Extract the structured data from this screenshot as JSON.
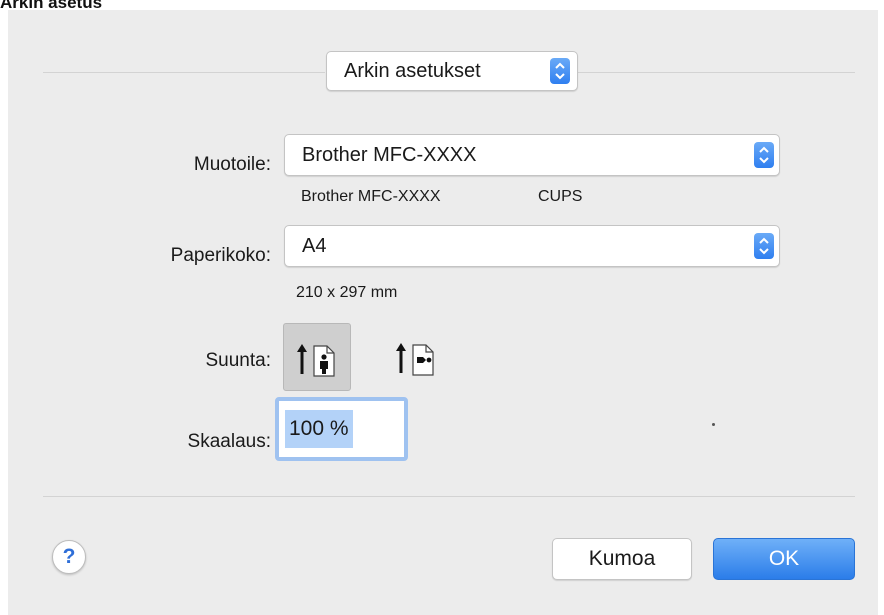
{
  "page": {
    "heading": "Arkin asetus"
  },
  "dialog": {
    "settings_popup": {
      "value": "Arkin asetukset"
    },
    "format_for": {
      "label": "Muotoile:",
      "value": "Brother MFC-XXXX",
      "details": {
        "model": "Brother MFC-XXXX",
        "driver": "CUPS"
      }
    },
    "paper_size": {
      "label": "Paperikoko:",
      "value": "A4",
      "dimensions": "210 x 297 mm"
    },
    "orientation": {
      "label": "Suunta:",
      "options": [
        {
          "name": "portrait",
          "selected": true
        },
        {
          "name": "landscape",
          "selected": false
        }
      ]
    },
    "scale": {
      "label": "Skaalaus:",
      "value": "100 %"
    },
    "buttons": {
      "help": "?",
      "cancel": "Kumoa",
      "ok": "OK"
    }
  },
  "colors": {
    "accent": "#2f7ff0",
    "dialog_bg": "#ececec",
    "selection": "#b3d2f8"
  }
}
